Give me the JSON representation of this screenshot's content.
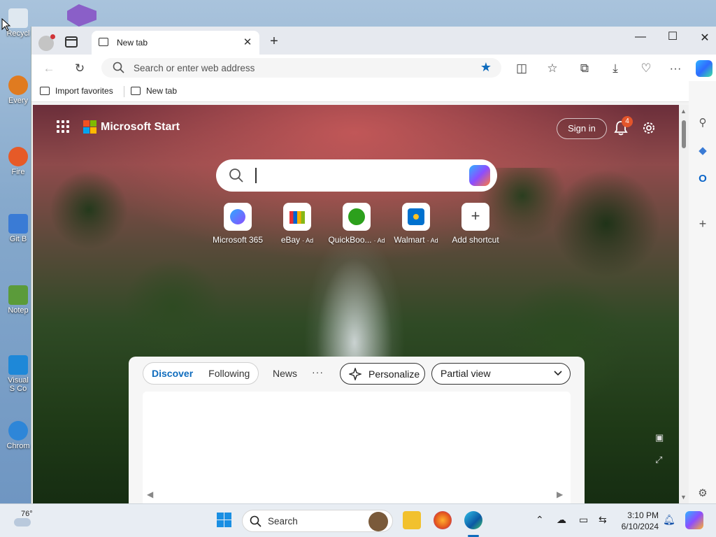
{
  "desktop": {
    "icons": [
      {
        "label": "Recycl",
        "color": "#5aa0d8"
      },
      {
        "label": "Every",
        "color": "#e07b20"
      },
      {
        "label": "Fire",
        "color": "#e65a28"
      },
      {
        "label": "Git B",
        "color": "#3a7bd5"
      },
      {
        "label": "Notep",
        "color": "#5b9b3a"
      },
      {
        "label": "Visual S Co",
        "color": "#1e88d8"
      },
      {
        "label": "Chrom",
        "color": "#2e86d8"
      }
    ]
  },
  "browser": {
    "tab_title": "New tab",
    "address_placeholder": "Search or enter web address",
    "favorites": {
      "import_label": "Import favorites",
      "newtab_label": "New tab"
    }
  },
  "newtab": {
    "brand": "Microsoft Start",
    "sign_in": "Sign in",
    "notification_count": "4",
    "shortcuts": [
      {
        "label": "Microsoft 365",
        "ad": ""
      },
      {
        "label": "eBay",
        "ad": "· Ad"
      },
      {
        "label": "QuickBoo...",
        "ad": "· Ad"
      },
      {
        "label": "Walmart",
        "ad": "· Ad"
      },
      {
        "label": "Add shortcut",
        "ad": ""
      }
    ],
    "feed": {
      "tabs": [
        "Discover",
        "Following"
      ],
      "news": "News",
      "more": "···",
      "personalize": "Personalize",
      "view_select": "Partial view"
    }
  },
  "taskbar": {
    "temperature": "76°",
    "search_label": "Search",
    "time": "3:10 PM",
    "date": "6/10/2024"
  },
  "colors": {
    "accent": "#0f6cbd",
    "badge": "#e3552b"
  }
}
